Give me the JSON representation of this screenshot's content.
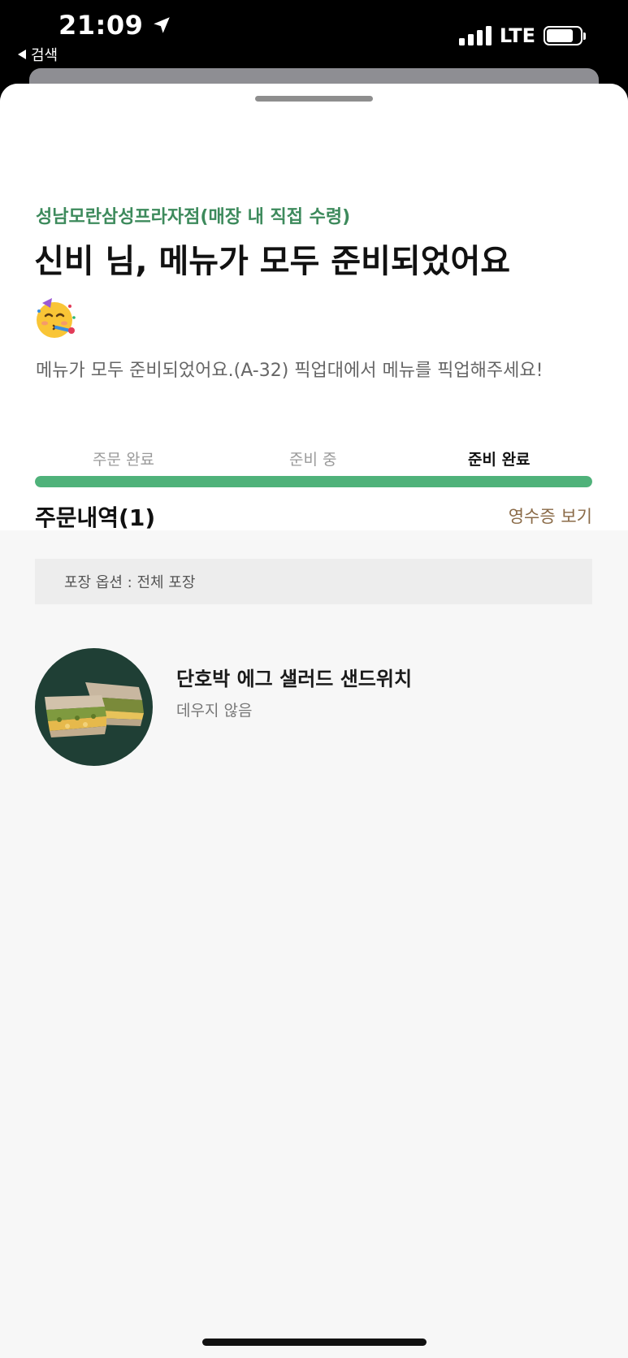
{
  "status_bar": {
    "time": "21:09",
    "back_label": "검색",
    "network": "LTE"
  },
  "order_status": {
    "store_name": "성남모란삼성프라자점(매장 내 직접 수령)",
    "headline": "신비 님, 메뉴가 모두 준비되었어요",
    "celebration_emoji": "partying-face-icon",
    "message": "메뉴가 모두 준비되었어요.(A-32)   픽업대에서 메뉴를 픽업해주세요!",
    "steps": [
      {
        "label": "주문 완료",
        "state": "passed"
      },
      {
        "label": "준비 중",
        "state": "passed"
      },
      {
        "label": "준비 완료",
        "state": "current"
      }
    ],
    "progress_percent": 100,
    "accent_color": "#3d8a5c",
    "progress_color": "#4fb27a"
  },
  "order_details": {
    "title": "주문내역(1)",
    "receipt_link": "영수증 보기",
    "packaging_option": "포장 옵션 : 전체 포장",
    "items": [
      {
        "name": "단호박 에그 샐러드 샌드위치",
        "option": "데우지 않음",
        "thumbnail": "sandwich-image"
      }
    ]
  }
}
